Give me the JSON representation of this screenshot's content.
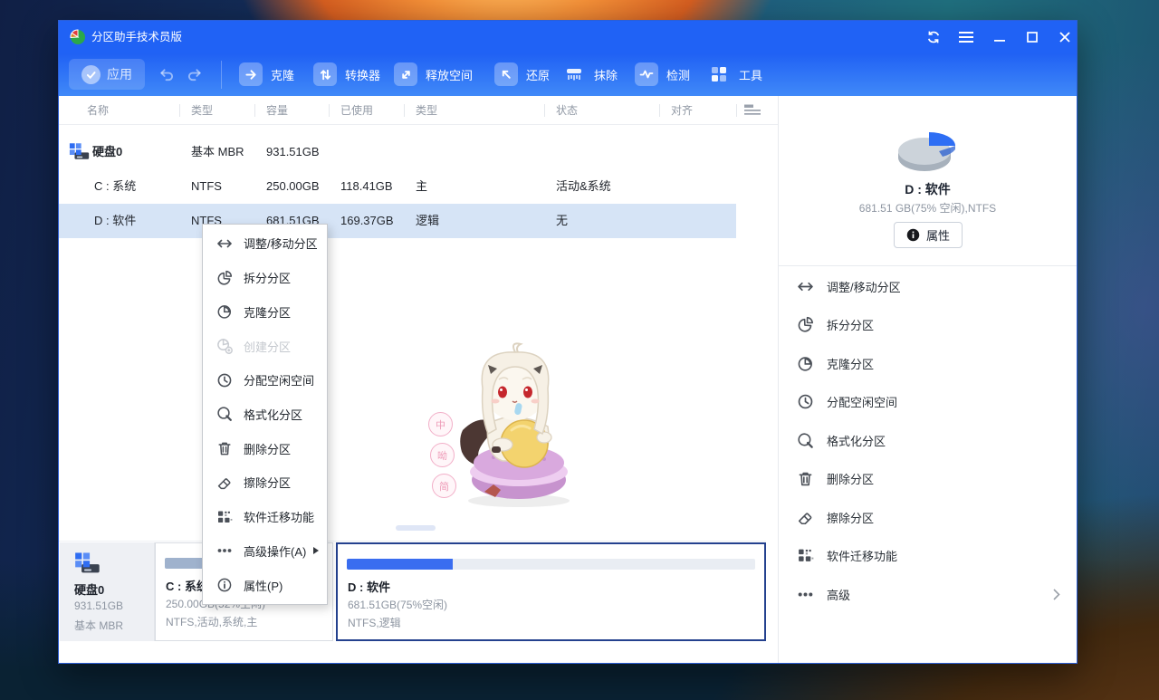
{
  "app": {
    "title": "分区助手技术员版"
  },
  "toolbar": {
    "apply_label": "应用",
    "buttons": [
      {
        "label": "克隆"
      },
      {
        "label": "转换器"
      },
      {
        "label": "释放空间"
      },
      {
        "label": "还原"
      },
      {
        "label": "抹除"
      },
      {
        "label": "检测"
      },
      {
        "label": "工具"
      }
    ]
  },
  "table": {
    "headers": [
      "名称",
      "类型",
      "容量",
      "已使用",
      "类型",
      "状态",
      "对齐"
    ],
    "rows": [
      {
        "name": "硬盘0",
        "type": "基本 MBR",
        "capacity": "931.51GB",
        "used": "",
        "part_type": "",
        "status": ""
      },
      {
        "name": "C : 系统",
        "type": "NTFS",
        "capacity": "250.00GB",
        "used": "118.41GB",
        "part_type": "主",
        "status": "活动&系统"
      },
      {
        "name": "D : 软件",
        "type": "NTFS",
        "capacity": "681.51GB",
        "used": "169.37GB",
        "part_type": "逻辑",
        "status": "无"
      }
    ]
  },
  "context_menu": {
    "items": [
      {
        "label": "调整/移动分区"
      },
      {
        "label": "拆分分区"
      },
      {
        "label": "克隆分区"
      },
      {
        "label": "创建分区",
        "disabled": true
      },
      {
        "label": "分配空闲空间"
      },
      {
        "label": "格式化分区"
      },
      {
        "label": "删除分区"
      },
      {
        "label": "擦除分区"
      },
      {
        "label": "软件迁移功能"
      },
      {
        "label": "高级操作(A)",
        "submenu": true
      },
      {
        "label": "属性(P)"
      }
    ]
  },
  "right_panel": {
    "selected_title": "D : 软件",
    "selected_subtitle": "681.51 GB(75% 空闲),NTFS",
    "properties_label": "属性",
    "free_pct": 75,
    "actions": [
      {
        "label": "调整/移动分区"
      },
      {
        "label": "拆分分区"
      },
      {
        "label": "克隆分区"
      },
      {
        "label": "分配空闲空间"
      },
      {
        "label": "格式化分区"
      },
      {
        "label": "删除分区"
      },
      {
        "label": "擦除分区"
      },
      {
        "label": "软件迁移功能"
      },
      {
        "label": "高级",
        "submenu": true
      }
    ]
  },
  "bottom": {
    "disk": {
      "name": "硬盘0",
      "capacity": "931.51GB",
      "type": "基本 MBR"
    },
    "partitions": [
      {
        "name": "C : 系统",
        "capacity": "250.00GB(52%空闲)",
        "fs": "NTFS,活动,系统,主",
        "used_pct": 48
      },
      {
        "name": "D : 软件",
        "capacity": "681.51GB(75%空闲)",
        "fs": "NTFS,逻辑",
        "used_pct": 26
      }
    ]
  },
  "mascot": {
    "badges": [
      "中",
      "呦",
      "简"
    ]
  },
  "colors": {
    "titlebar": "#2062f5",
    "accent": "#2e6ef4",
    "selected_row": "#d6e4f6",
    "c_bar_used": "#9fb2cd",
    "d_bar_used": "#3a6df0"
  }
}
